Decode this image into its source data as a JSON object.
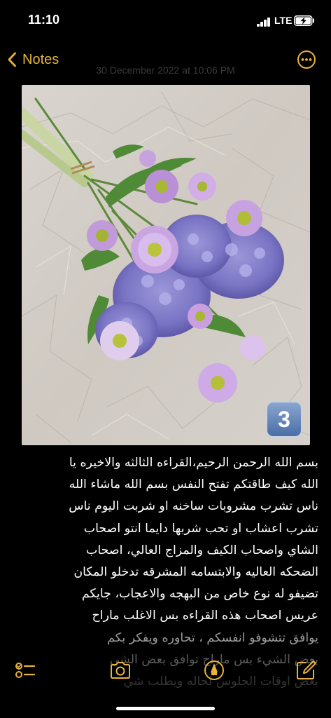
{
  "status_bar": {
    "time": "11:10",
    "network": "LTE",
    "signal_bars": 4,
    "battery_charging": true
  },
  "nav": {
    "back_label": "Notes",
    "date": "30 December 2022 at 10:06 PM",
    "more_icon": "ellipsis-circle-icon",
    "accent_color": "#E8B338"
  },
  "photo": {
    "badge_number": "3"
  },
  "note": {
    "lines": [
      "بسم الله الرحمن الرحيم،القراءه الثالثه والاخيره يا",
      "الله كيف طاقتكم تفتح النفس بسم الله ماشاء الله",
      "ناس تشرب مشروبات ساخنه او شربت اليوم ناس",
      "تشرب اعشاب او تحب شربها دايما انتو اصحاب",
      "الشاي واصحاب الكيف والمزاج العالي، اصحاب",
      "الضحكه العاليه والابتسامه المشرقه تدخلو المكان",
      "تضيفو له نوع خاص من البهجه والاعجاب، جايكم",
      "عريس اصحاب هذه القراءه بس الاغلب ماراح",
      "يوافق تتشوفو انفسكم ، تحاوره ويفكر بكم",
      "بعض الشيء بس ماراح توافق بعض الشي",
      "بعض اوقات الجلوس لحاله ويطلب شي"
    ]
  },
  "toolbar": {
    "checklist_icon": "checklist-icon",
    "camera_icon": "camera-icon",
    "markup_icon": "markup-pen-icon",
    "compose_icon": "compose-icon"
  }
}
